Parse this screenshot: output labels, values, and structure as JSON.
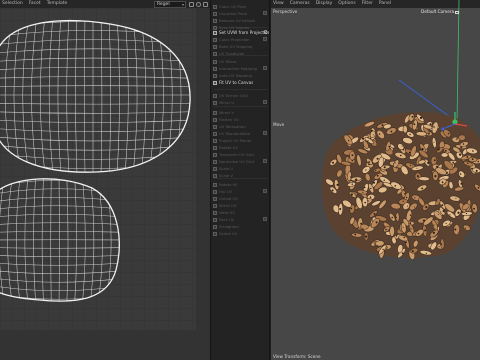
{
  "uv_editor": {
    "menu": [
      "Selection",
      "Facet",
      "Template"
    ],
    "projection_select": "Regel",
    "view_icons": [
      "grid-icon",
      "eye-icon",
      "lock-icon"
    ]
  },
  "tools": {
    "items": [
      {
        "label": "Cubic UV Pack",
        "active": false
      },
      {
        "label": "Unpacker Pack",
        "active": false
      },
      {
        "label": "Remove UV Islands",
        "active": false
      },
      {
        "label": "Sync UV Islands",
        "active": false
      },
      {
        "label": "Set UVW from Projection",
        "active": true,
        "gear": true
      },
      {
        "label": "Cubic Projection",
        "active": false
      },
      {
        "label": "Bake UV Mapping",
        "active": false
      },
      {
        "label": "UV Subdivide",
        "active": false
      },
      {
        "label": "UV Mirror",
        "active": false
      },
      {
        "label": "Interactive Mapping",
        "active": false
      },
      {
        "label": "Auto UV Mapping",
        "active": false
      },
      {
        "label": "Fit UV to Canvas",
        "active": true
      },
      {
        "label": "UV Terrain Grid",
        "active": false
      },
      {
        "label": "Mirror U",
        "active": false
      },
      {
        "label": "Mirror V",
        "active": false
      },
      {
        "label": "Flatten UV",
        "active": false
      },
      {
        "label": "UV Relaxation",
        "active": false
      },
      {
        "label": "UV Manipulation",
        "active": false
      },
      {
        "label": "Project UV Points",
        "active": false
      },
      {
        "label": "Rotate UV",
        "active": false
      },
      {
        "label": "Transform UV Grid",
        "active": false
      },
      {
        "label": "Normalize UV Grid",
        "active": false
      },
      {
        "label": "Scale U",
        "active": false
      },
      {
        "label": "Scale V",
        "active": false
      },
      {
        "label": "Rotate 90",
        "active": false
      },
      {
        "label": "Flip UV",
        "active": false
      },
      {
        "label": "Unfold UV",
        "active": false
      },
      {
        "label": "Stitch UV",
        "active": false
      },
      {
        "label": "Weld UV",
        "active": false
      },
      {
        "label": "Pack UV",
        "active": false
      },
      {
        "label": "Straighten",
        "active": false
      },
      {
        "label": "Select UV",
        "active": false
      }
    ]
  },
  "viewport": {
    "menu": [
      "View",
      "Cameras",
      "Display",
      "Options",
      "Filter",
      "Panel"
    ],
    "projection_label": "Perspective",
    "camera_label": "Default Camera",
    "axis_marker": "Move",
    "bottom_label": "View Transform: Scene",
    "colors": {
      "background": "#474747",
      "axis_green": "#3fbf6a",
      "axis_blue": "#3a63d6",
      "object_tan": "#c99a6a",
      "object_dark": "#3a2a1e"
    }
  }
}
